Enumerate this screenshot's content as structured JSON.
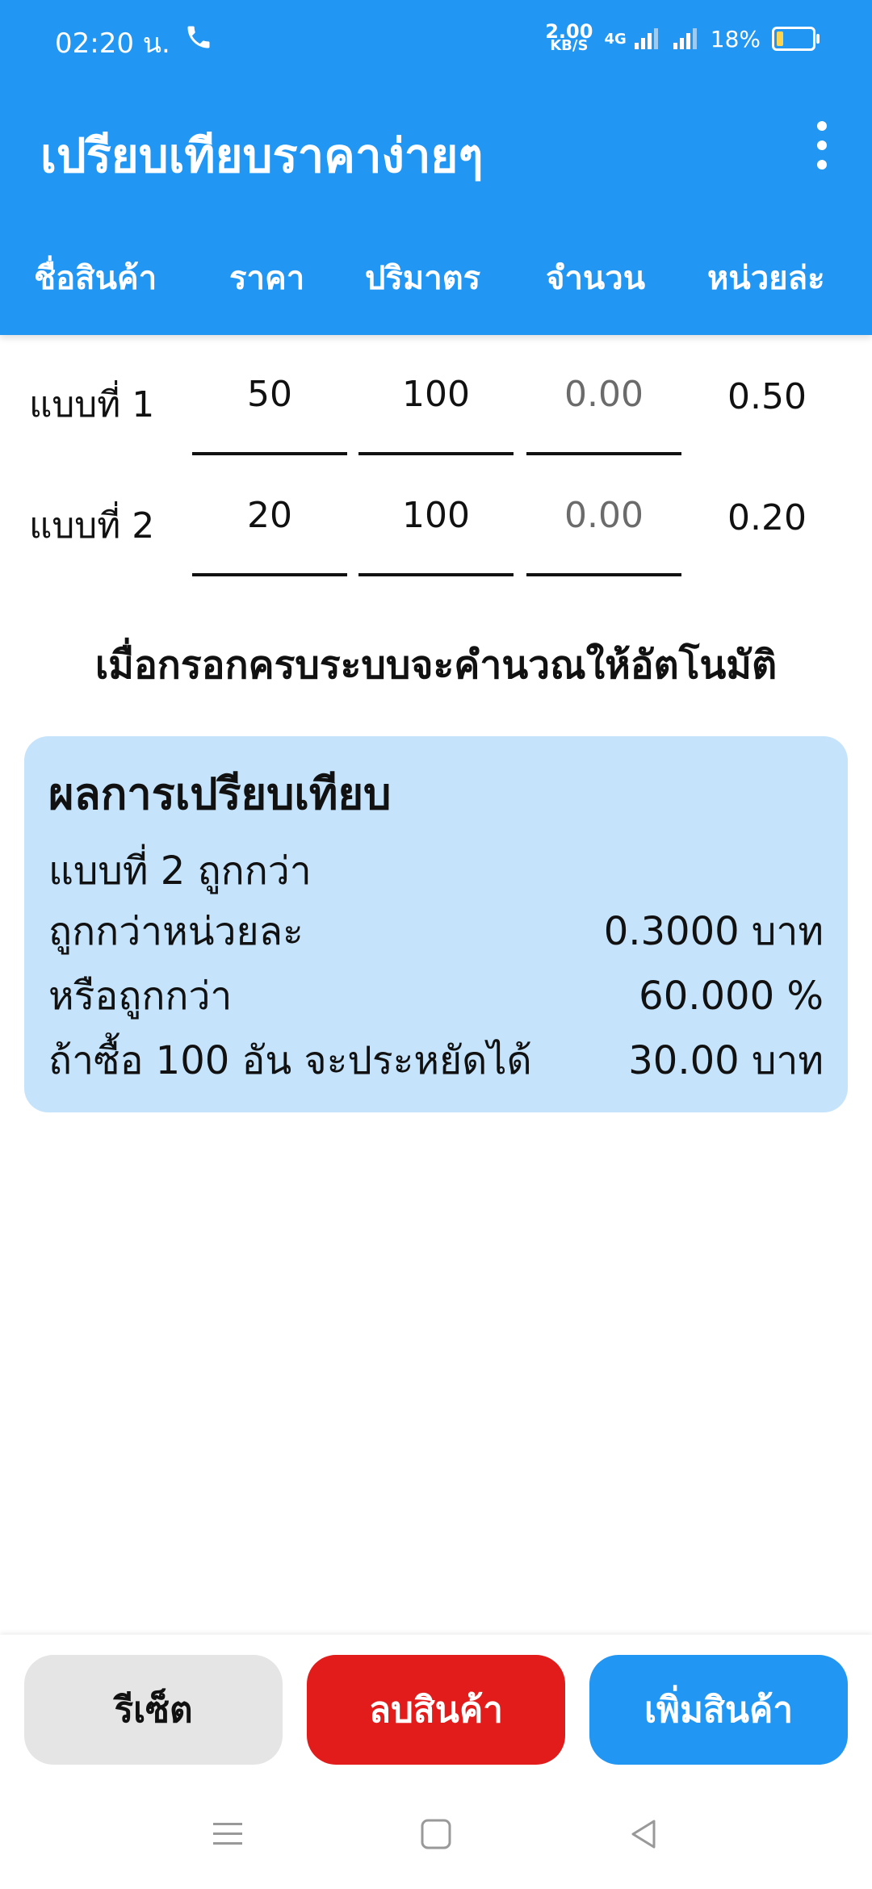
{
  "status": {
    "time": "02:20 น.",
    "net_speed_value": "2.00",
    "net_speed_unit": "KB/S",
    "network": "4G",
    "battery": "18%"
  },
  "app": {
    "title": "เปรียบเทียบราคาง่ายๆ"
  },
  "columns": [
    "ชื่อสินค้า",
    "ราคา",
    "ปริมาตร",
    "จำนวน",
    "หน่วยล่ะ"
  ],
  "rows": [
    {
      "label": "แบบที่ 1",
      "price": "50",
      "volume": "100",
      "quantity": "0.00",
      "unit_price": "0.50"
    },
    {
      "label": "แบบที่ 2",
      "price": "20",
      "volume": "100",
      "quantity": "0.00",
      "unit_price": "0.20"
    }
  ],
  "hint": "เมื่อกรอกครบระบบจะคำนวณให้อัตโนมัติ",
  "result": {
    "title": "ผลการเปรียบเทียบ",
    "winner": "แบบที่ 2 ถูกกว่า",
    "per_unit_label": "ถูกกว่าหน่วยละ",
    "per_unit_value": "0.3000 บาท",
    "percent_label": "หรือถูกกว่า",
    "percent_value": "60.000 %",
    "save_label": "ถ้าซื้อ 100 อัน จะประหยัดได้",
    "save_value": "30.00 บาท"
  },
  "buttons": {
    "reset": "รีเซ็ต",
    "delete": "ลบสินค้า",
    "add": "เพิ่มสินค้า"
  },
  "colors": {
    "primary": "#2196F3",
    "danger": "#E21B1B",
    "result_bg": "#C5E3FB"
  }
}
